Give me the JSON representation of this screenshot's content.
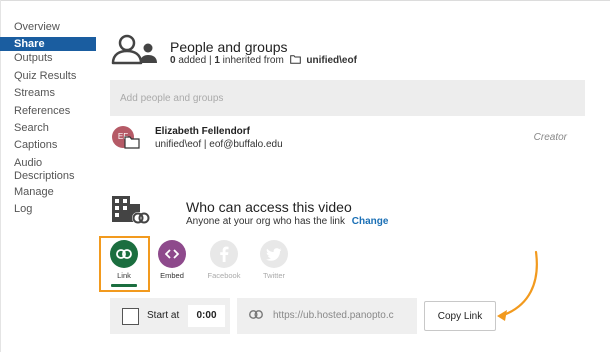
{
  "sidebar": {
    "items": [
      {
        "label": "Overview"
      },
      {
        "label": "Share",
        "active": true
      },
      {
        "label": "Outputs"
      },
      {
        "label": "Quiz Results"
      },
      {
        "label": "Streams"
      },
      {
        "label": "References"
      },
      {
        "label": "Search"
      },
      {
        "label": "Captions"
      },
      {
        "label": "Audio Descriptions"
      },
      {
        "label": "Manage"
      },
      {
        "label": "Log"
      }
    ]
  },
  "people": {
    "title": "People and groups",
    "added_count": "0",
    "added_label": "added",
    "separator": "|",
    "inherited_count": "1",
    "inherited_label": "inherited from",
    "folder_name": "unified\\eof",
    "icon": "people-icon",
    "add_placeholder": "Add people and groups"
  },
  "users": [
    {
      "initials": "EF",
      "name": "Elizabeth Fellendorf",
      "meta": "unified\\eof | eof@buffalo.edu",
      "role": "Creator",
      "avatar_color": "#b55a66"
    }
  ],
  "access": {
    "title": "Who can access this video",
    "description": "Anyone at your org who has the link",
    "change_label": "Change",
    "icon": "building-link-icon"
  },
  "share_options": {
    "link": {
      "label": "Link",
      "color": "#1b6e3f",
      "icon": "link-icon"
    },
    "embed": {
      "label": "Embed",
      "color": "#8e4a8c",
      "icon": "code-icon"
    },
    "facebook": {
      "label": "Facebook",
      "color": "#e8e8e8",
      "icon": "facebook-icon"
    },
    "twitter": {
      "label": "Twitter",
      "color": "#e8e8e8",
      "icon": "twitter-icon"
    }
  },
  "start": {
    "label": "Start at",
    "time": "0:00"
  },
  "url": {
    "value": "https://ub.hosted.panopto.c"
  },
  "copy_button": "Copy Link",
  "colors": {
    "active_nav": "#1a5da0",
    "highlight": "#f29a1e",
    "change_link": "#1a6fb5"
  }
}
